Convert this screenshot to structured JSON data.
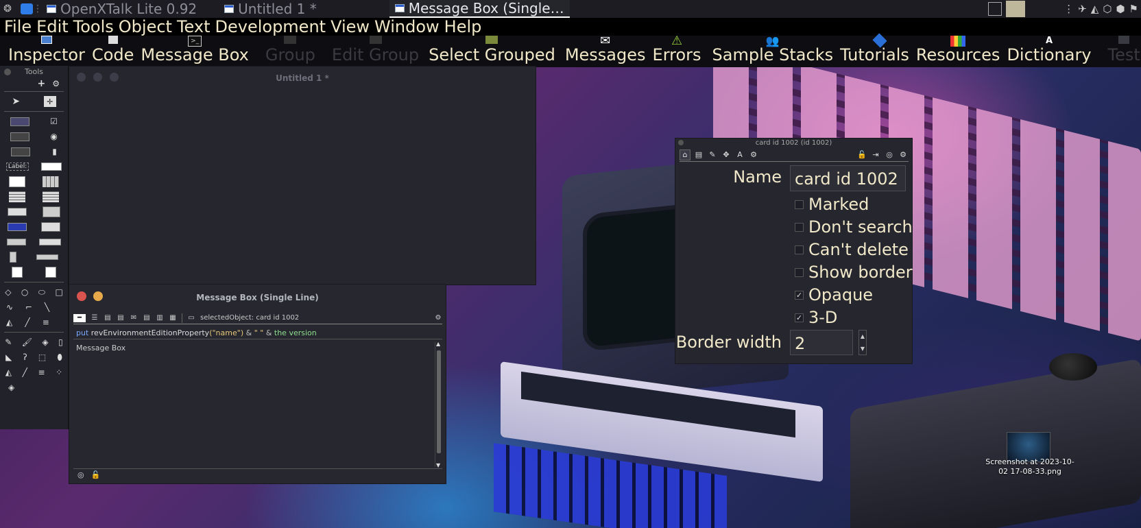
{
  "taskbar": {
    "items": [
      {
        "label": "OpenXTalk Lite 0.92",
        "active": false
      },
      {
        "label": "Untitled 1 *",
        "active": false
      },
      {
        "label": "Message Box (Single…",
        "active": true
      }
    ]
  },
  "menubar": {
    "items": [
      "File",
      "Edit",
      "Tools",
      "Object",
      "Text",
      "Development",
      "View",
      "Window",
      "Help"
    ]
  },
  "toolbar": {
    "items": [
      {
        "label": "Inspector",
        "icon": "inspector-icon",
        "enabled": true
      },
      {
        "label": "Code",
        "icon": "code-icon",
        "enabled": true
      },
      {
        "label": "Message Box",
        "icon": "message-box-icon",
        "enabled": true
      },
      {
        "label": "Group",
        "icon": "group-icon",
        "enabled": false
      },
      {
        "label": "Edit Group",
        "icon": "edit-group-icon",
        "enabled": false
      },
      {
        "label": "Select Grouped",
        "icon": "select-grouped-icon",
        "enabled": true
      },
      {
        "label": "Messages",
        "icon": "envelope-icon",
        "enabled": true
      },
      {
        "label": "Errors",
        "icon": "warning-icon",
        "enabled": true
      },
      {
        "label": "Sample Stacks",
        "icon": "users-icon",
        "enabled": true
      },
      {
        "label": "Tutorials",
        "icon": "tutorials-icon",
        "enabled": true
      },
      {
        "label": "Resources",
        "icon": "books-icon",
        "enabled": true
      },
      {
        "label": "Dictionary",
        "icon": "dictionary-icon",
        "enabled": true
      },
      {
        "label": "Test",
        "icon": "test-icon",
        "enabled": false
      }
    ]
  },
  "tools": {
    "title": "Tools",
    "label_widget": "Label:"
  },
  "untitled": {
    "title": "Untitled 1 *"
  },
  "message_box": {
    "title": "Message Box (Single Line)",
    "selected_object": "selectedObject: card id 1002",
    "input": {
      "kw": "put",
      "fn": "revEnvironmentEditionProperty",
      "lparen": "(",
      "str1": "\"name\"",
      "rparen": ")",
      "amp1": "&",
      "str2": "\" \"",
      "amp2": "&",
      "tail": "the version"
    },
    "results": "Message Box"
  },
  "inspector": {
    "title": "card id 1002 (id 1002)",
    "name_label": "Name",
    "name_value": "card id 1002",
    "checkboxes": [
      {
        "label": "Marked",
        "checked": false
      },
      {
        "label": "Don't search",
        "checked": false
      },
      {
        "label": "Can't delete",
        "checked": false
      },
      {
        "label": "Show border",
        "checked": false
      },
      {
        "label": "Opaque",
        "checked": true
      },
      {
        "label": "3-D",
        "checked": true
      }
    ],
    "border_width_label": "Border width",
    "border_width_value": "2"
  },
  "desktop": {
    "file_label": "Screenshot at 2023-10-02 17-08-33.png"
  },
  "colors": {
    "keyword": "#7aa7ff",
    "string": "#e8c87a",
    "theVersion": "#8ee08e",
    "menu_text": "#f0e8c8"
  }
}
